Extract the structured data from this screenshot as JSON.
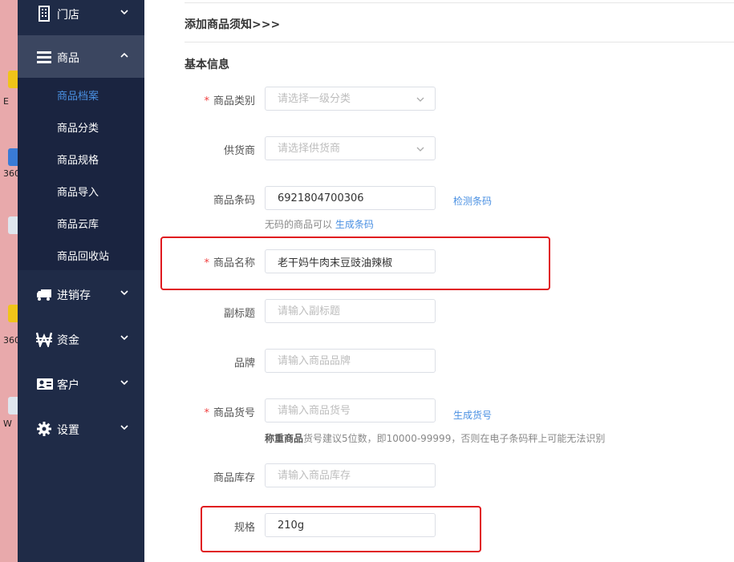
{
  "desktop": {
    "labels": [
      "E",
      "360",
      "360",
      "W"
    ]
  },
  "sidebar": {
    "items": [
      {
        "label": "门店",
        "icon": "building-icon"
      },
      {
        "label": "商品",
        "icon": "menu-icon"
      },
      {
        "label": "进销存",
        "icon": "truck-icon"
      },
      {
        "label": "资金",
        "icon": "won-icon"
      },
      {
        "label": "客户",
        "icon": "id-card-icon"
      },
      {
        "label": "设置",
        "icon": "gear-icon"
      }
    ],
    "submenu": [
      {
        "label": "商品档案",
        "active": true
      },
      {
        "label": "商品分类"
      },
      {
        "label": "商品规格"
      },
      {
        "label": "商品导入"
      },
      {
        "label": "商品云库"
      },
      {
        "label": "商品回收站"
      }
    ]
  },
  "main": {
    "notice": "添加商品须知>>>",
    "section_title": "基本信息",
    "form": {
      "category": {
        "label": "商品类别",
        "placeholder": "请选择一级分类",
        "required": true
      },
      "supplier": {
        "label": "供货商",
        "placeholder": "请选择供货商"
      },
      "barcode": {
        "label": "商品条码",
        "value": "6921804700306",
        "link": "检测条码",
        "hint": "无码的商品可以",
        "hint_link": "生成条码"
      },
      "name": {
        "label": "商品名称",
        "value": "老干妈牛肉末豆豉油辣椒",
        "required": true
      },
      "subtitle": {
        "label": "副标题",
        "placeholder": "请输入副标题"
      },
      "brand": {
        "label": "品牌",
        "placeholder": "请输入商品品牌"
      },
      "sku": {
        "label": "商品货号",
        "placeholder": "请输入商品货号",
        "required": true,
        "link": "生成货号",
        "hint_bold": "称重商品",
        "hint": "货号建议5位数，即10000-99999，否则在电子条码秤上可能无法识别"
      },
      "stock": {
        "label": "商品库存",
        "placeholder": "请输入商品库存"
      },
      "spec": {
        "label": "规格",
        "value": "210g"
      }
    }
  },
  "colors": {
    "sidebar": "#1f2b47",
    "accent": "#4a90e2",
    "required": "#f04040",
    "highlight": "#e0191f"
  }
}
